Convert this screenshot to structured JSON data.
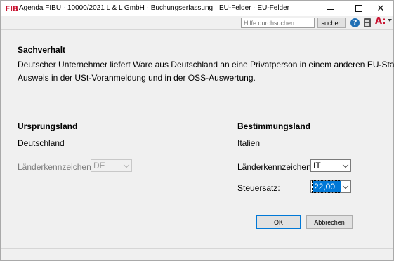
{
  "window": {
    "logo": "FIB",
    "title": "Agenda FIBU · 10000/2021 L & L GmbH · Buchungserfassung · EU-Felder · EU-Felder"
  },
  "toolbar": {
    "search_placeholder": "Hilfe durchsuchen...",
    "search_button": "suchen",
    "help_icon": "?",
    "accessibility_icon": "A:"
  },
  "sachverhalt": {
    "heading": "Sachverhalt",
    "line1": "Deutscher Unternehmer liefert Ware aus Deutschland an eine Privatperson in einem anderen EU-Staat.",
    "line2": "Ausweis in der USt-Voranmeldung und in der OSS-Auswertung."
  },
  "ursprungsland": {
    "heading": "Ursprungsland",
    "country": "Deutschland",
    "code_label": "Länderkennzeichen:",
    "code_value": "DE"
  },
  "bestimmungsland": {
    "heading": "Bestimmungsland",
    "country": "Italien",
    "code_label": "Länderkennzeichen:",
    "code_value": "IT",
    "rate_label": "Steuersatz:",
    "rate_value": "22,00"
  },
  "buttons": {
    "ok": "OK",
    "cancel": "Abbrechen"
  }
}
